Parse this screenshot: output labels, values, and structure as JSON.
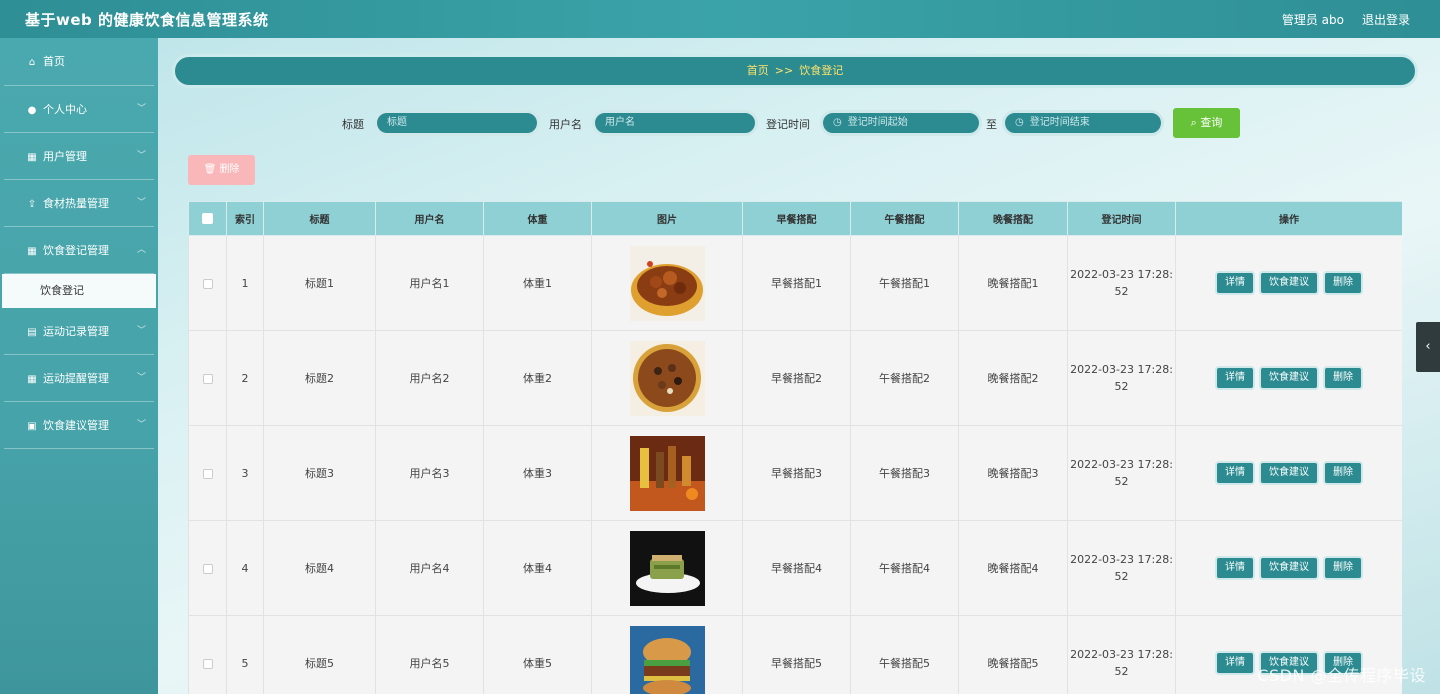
{
  "app": {
    "title": "基于web 的健康饮食信息管理系统",
    "user": "管理员 abo",
    "logout": "退出登录"
  },
  "sidebar": {
    "items": [
      {
        "label": "首页",
        "icon": "home-icon",
        "glyph": "⌂",
        "chevron": false
      },
      {
        "label": "个人中心",
        "icon": "user-icon",
        "glyph": "👤",
        "chevron": true
      },
      {
        "label": "用户管理",
        "icon": "grid-icon",
        "glyph": "▦",
        "chevron": true
      },
      {
        "label": "食材热量管理",
        "icon": "upload-icon",
        "glyph": "⇪",
        "chevron": true
      },
      {
        "label": "饮食登记管理",
        "icon": "grid-icon",
        "glyph": "▦",
        "chevron": true
      }
    ],
    "sub_active": "饮食登记",
    "items_after": [
      {
        "label": "运动记录管理",
        "icon": "doc-icon",
        "glyph": "▤",
        "chevron": true
      },
      {
        "label": "运动提醒管理",
        "icon": "grid-icon",
        "glyph": "▦",
        "chevron": true
      },
      {
        "label": "饮食建议管理",
        "icon": "clipboard-icon",
        "glyph": "▣",
        "chevron": true
      }
    ]
  },
  "breadcrumb": {
    "home": "首页",
    "sep": ">>",
    "current": "饮食登记"
  },
  "search": {
    "title_label": "标题",
    "title_placeholder": "标题",
    "username_label": "用户名",
    "username_placeholder": "用户名",
    "time_label": "登记时间",
    "time_start_placeholder": "登记时间起始",
    "to_label": "至",
    "time_end_placeholder": "登记时间结束",
    "query_button": "查询"
  },
  "toolbar": {
    "delete_button": "删除"
  },
  "table": {
    "headers": [
      "",
      "索引",
      "标题",
      "用户名",
      "体重",
      "图片",
      "早餐搭配",
      "午餐搭配",
      "晚餐搭配",
      "登记时间",
      "操作"
    ],
    "rows": [
      {
        "index": "1",
        "title": "标题1",
        "username": "用户名1",
        "weight": "体重1",
        "breakfast": "早餐搭配1",
        "lunch": "午餐搭配1",
        "dinner": "晚餐搭配1",
        "time_a": "2022-03-23 17:28:",
        "time_b": "52"
      },
      {
        "index": "2",
        "title": "标题2",
        "username": "用户名2",
        "weight": "体重2",
        "breakfast": "早餐搭配2",
        "lunch": "午餐搭配2",
        "dinner": "晚餐搭配2",
        "time_a": "2022-03-23 17:28:",
        "time_b": "52"
      },
      {
        "index": "3",
        "title": "标题3",
        "username": "用户名3",
        "weight": "体重3",
        "breakfast": "早餐搭配3",
        "lunch": "午餐搭配3",
        "dinner": "晚餐搭配3",
        "time_a": "2022-03-23 17:28:",
        "time_b": "52"
      },
      {
        "index": "4",
        "title": "标题4",
        "username": "用户名4",
        "weight": "体重4",
        "breakfast": "早餐搭配4",
        "lunch": "午餐搭配4",
        "dinner": "晚餐搭配4",
        "time_a": "2022-03-23 17:28:",
        "time_b": "52"
      },
      {
        "index": "5",
        "title": "标题5",
        "username": "用户名5",
        "weight": "体重5",
        "breakfast": "早餐搭配5",
        "lunch": "午餐搭配5",
        "dinner": "晚餐搭配5",
        "time_a": "2022-03-23 17:28:",
        "time_b": "52"
      }
    ],
    "actions": {
      "detail": "详情",
      "advice": "饮食建议",
      "delete": "删除"
    }
  },
  "watermark": "CSDN @全传程序毕设",
  "colors": {
    "primary": "#2b8b91",
    "header_bg": "#8fd0d5",
    "query": "#67c23a",
    "delete_disabled": "#f9b7b9",
    "crumb_text": "#ffe36a"
  }
}
